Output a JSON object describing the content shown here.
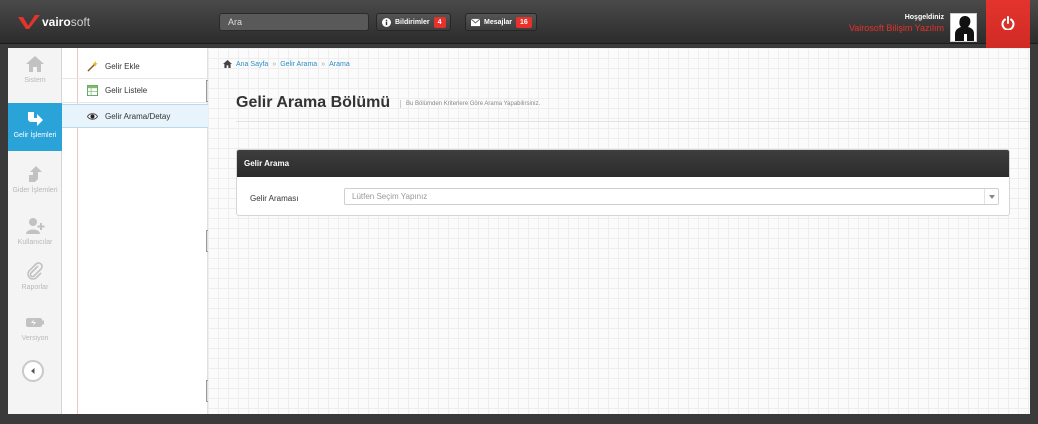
{
  "brand": {
    "name_bold": "vairo",
    "name_light": "soft"
  },
  "search": {
    "placeholder": "Ara"
  },
  "notifications": {
    "label": "Bildirimler",
    "count": "4"
  },
  "messages": {
    "label": "Mesajlar",
    "count": "16"
  },
  "user": {
    "greeting": "Hoşgeldiniz",
    "company": "Vairosoft Bilişim Yazılım"
  },
  "rail": {
    "items": [
      {
        "label": "Sistem",
        "icon": "home-icon",
        "active": false
      },
      {
        "label": "Gelir İşlemleri",
        "icon": "arrow-down-right-icon",
        "active": true
      },
      {
        "label": "Gider İşlemleri",
        "icon": "arrow-up-right-icon",
        "active": false
      },
      {
        "label": "Kullanıcılar",
        "icon": "add-user-icon",
        "active": false
      },
      {
        "label": "Raporlar",
        "icon": "paperclip-icon",
        "active": false
      },
      {
        "label": "Versiyon",
        "icon": "battery-icon",
        "active": false
      }
    ]
  },
  "submenu": {
    "items": [
      {
        "label": "Gelir Ekle",
        "icon": "wand-icon"
      },
      {
        "label": "Gelir Listele",
        "icon": "table-icon"
      },
      {
        "label": "Gelir Arama/Detay",
        "icon": "eye-icon"
      }
    ]
  },
  "breadcrumb": {
    "items": [
      "Ana Sayfa",
      "Gelir Arama",
      "Arama"
    ]
  },
  "page": {
    "title": "Gelir Arama Bölümü",
    "subtitle": "Bu Bölümden Kriterlere Göre Arama Yapabilirsiniz."
  },
  "panel": {
    "title": "Gelir Arama",
    "field_label": "Gelir Araması",
    "select_value": "Lütfen Seçim Yapınız"
  },
  "colors": {
    "accent": "#29a3d8",
    "brand_red": "#e3342c",
    "dark": "#2c2c2c"
  }
}
